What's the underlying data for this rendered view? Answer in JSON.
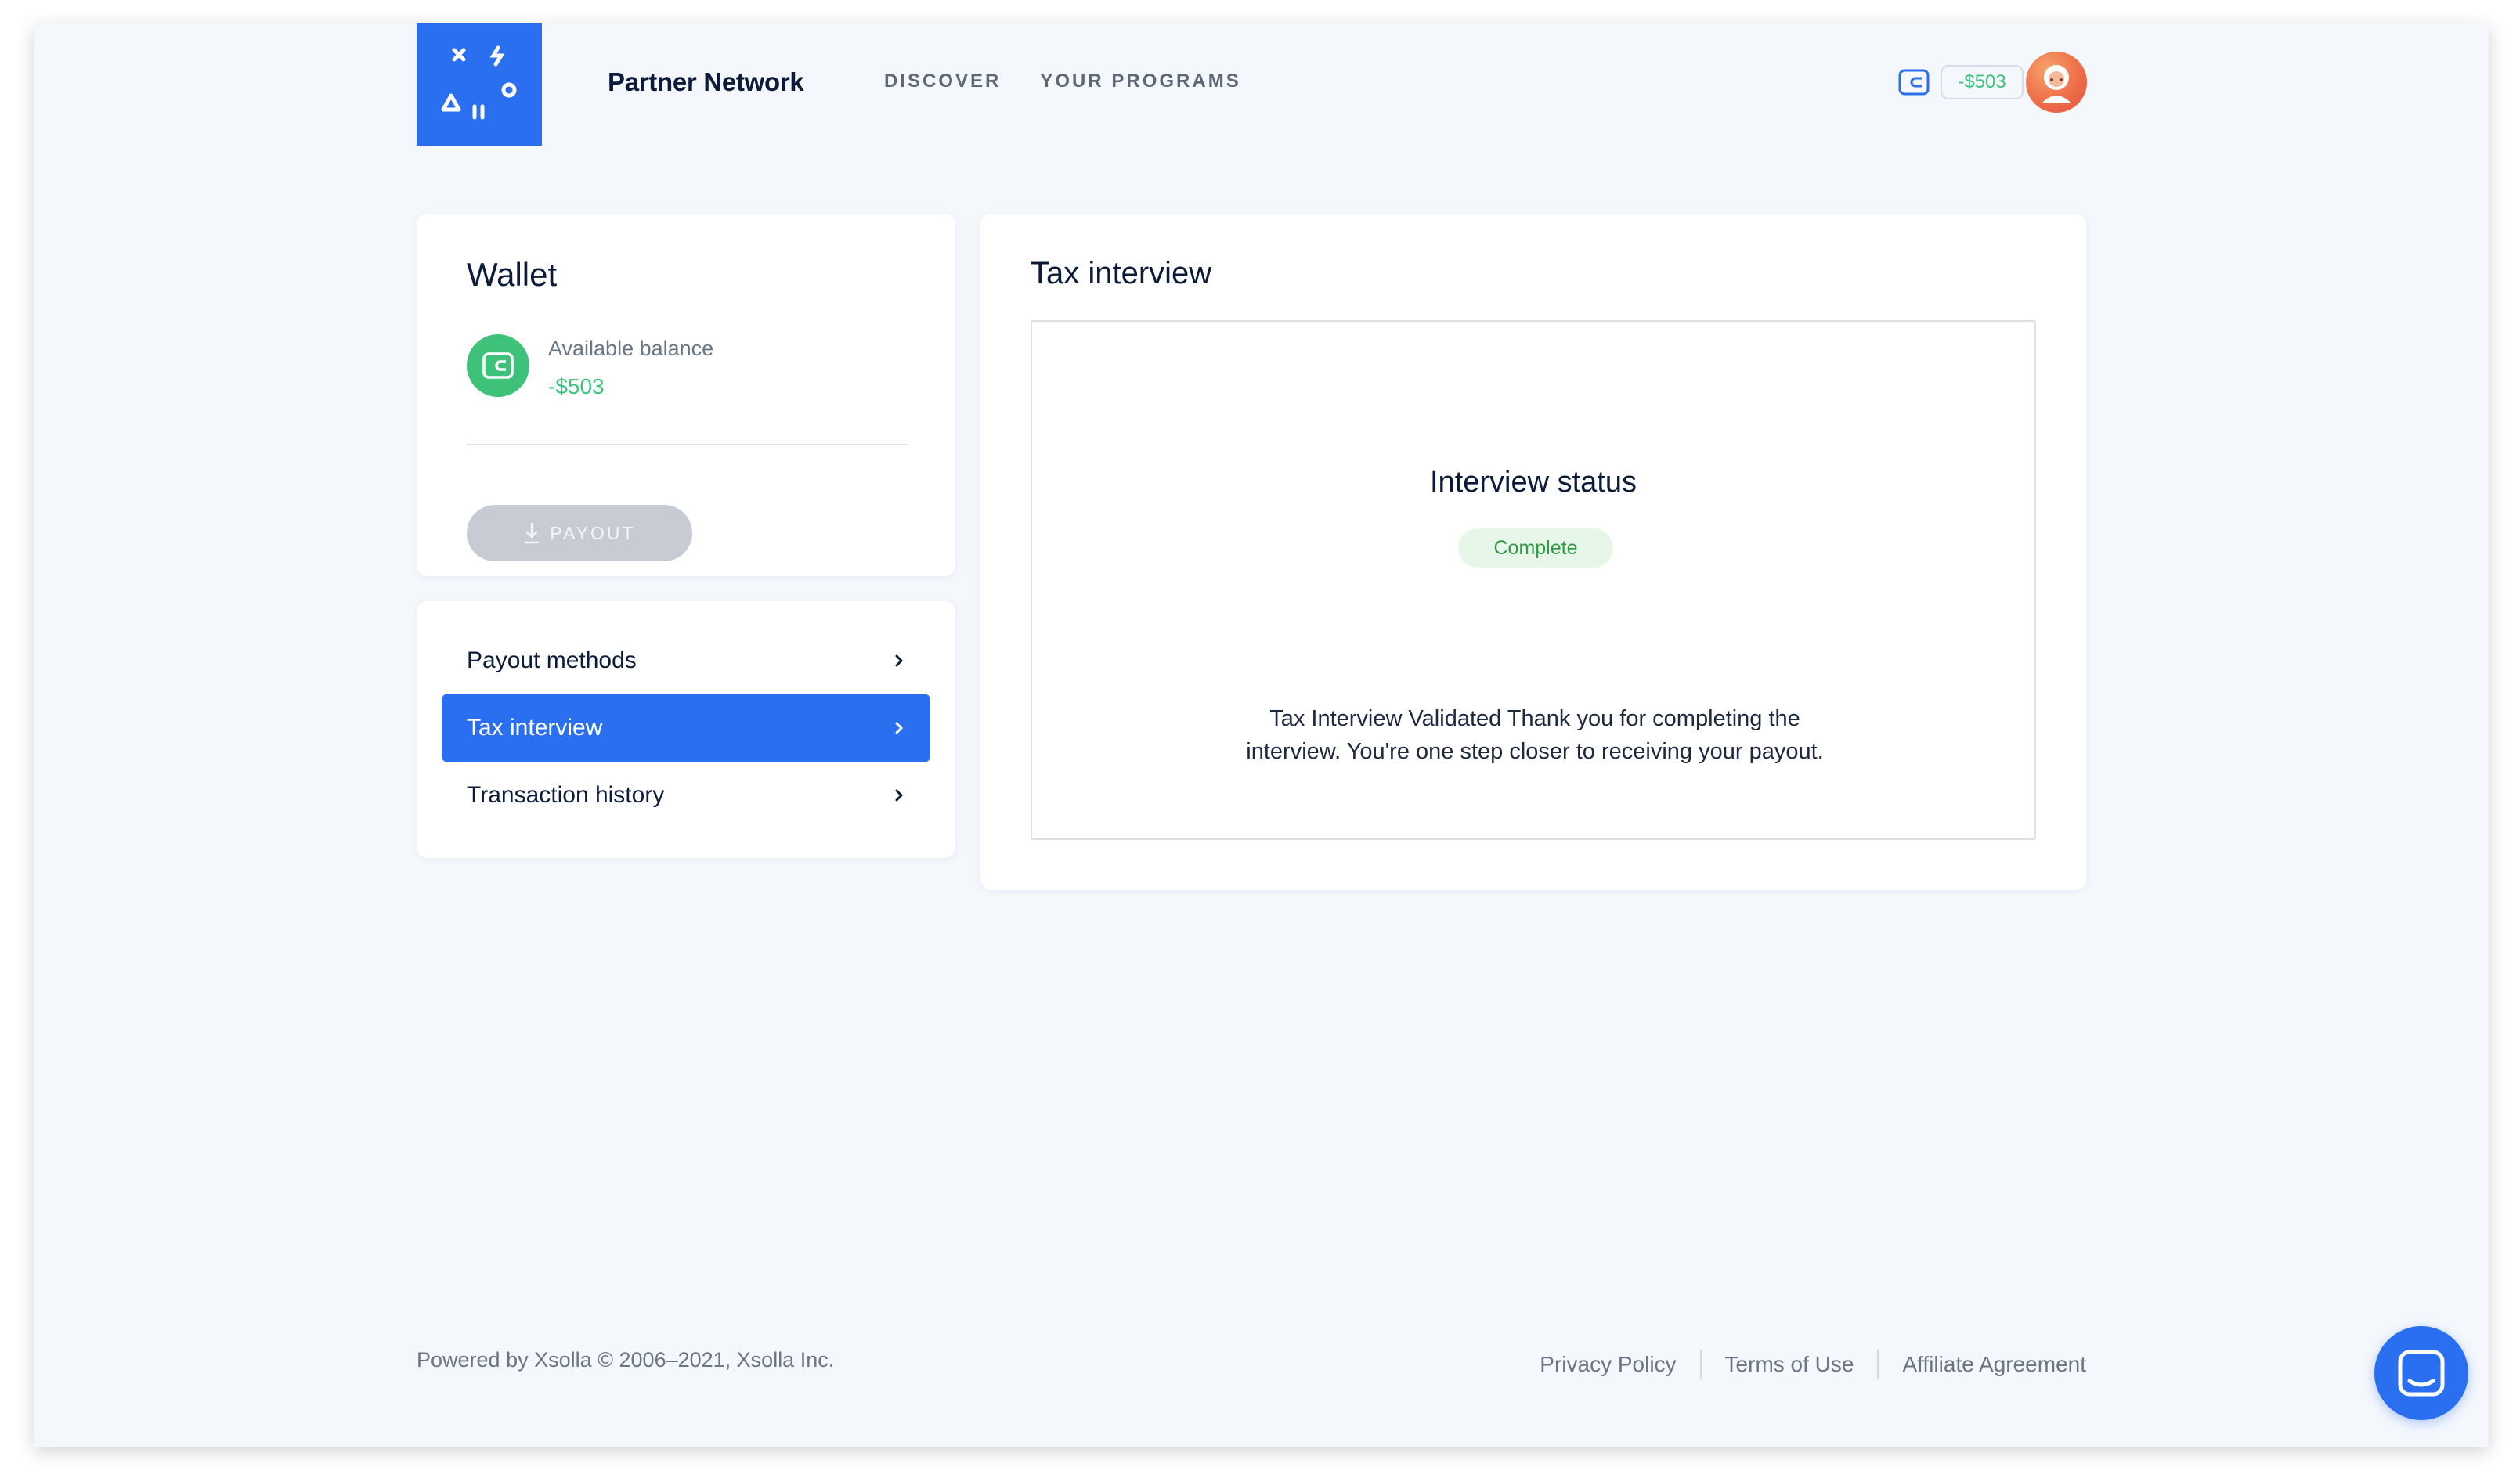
{
  "header": {
    "brand": "Partner Network",
    "nav": [
      {
        "label": "DISCOVER"
      },
      {
        "label": "YOUR PROGRAMS"
      }
    ],
    "balance": "-$503",
    "icons": {
      "wallet": "wallet-icon",
      "avatar": "user-avatar",
      "logo": "xsolla-logo"
    }
  },
  "wallet": {
    "title": "Wallet",
    "balance_label": "Available balance",
    "balance_value": "-$503",
    "payout_label": "PAYOUT"
  },
  "menu": {
    "items": [
      {
        "label": "Payout methods",
        "active": false
      },
      {
        "label": "Tax interview",
        "active": true
      },
      {
        "label": "Transaction history",
        "active": false
      }
    ]
  },
  "main": {
    "title": "Tax interview",
    "status_title": "Interview status",
    "status_badge": "Complete",
    "message": "Tax Interview Validated Thank you for completing the interview. You're one step closer to receiving your payout."
  },
  "footer": {
    "powered": "Powered by Xsolla © 2006–2021, Xsolla Inc.",
    "links": [
      "Privacy Policy",
      "Terms of Use",
      "Affiliate Agreement"
    ]
  },
  "colors": {
    "accent": "#2a6ff0",
    "positive": "#3ec27a",
    "status_complete_bg": "#e6f7e9",
    "status_complete_text": "#2f9c45"
  }
}
